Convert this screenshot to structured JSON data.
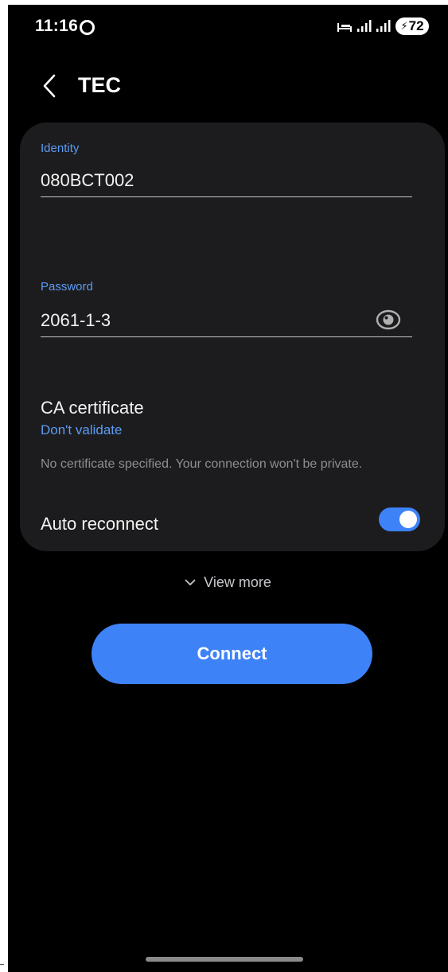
{
  "status_bar": {
    "time": "11:16",
    "battery_level": "72",
    "icons": [
      "circle-status-icon",
      "wifi-calling-icon",
      "signal-icon",
      "signal-icon",
      "battery-icon"
    ]
  },
  "header": {
    "title": "TEC",
    "back_icon": "chevron-left-icon"
  },
  "form": {
    "identity": {
      "label": "Identity",
      "value": "080BCT002"
    },
    "password": {
      "label": "Password",
      "value": "2061-1-3",
      "visibility_icon": "eye-icon"
    },
    "ca_certificate": {
      "label": "CA certificate",
      "value": "Don't validate",
      "note": "No certificate specified. Your connection won't be private."
    },
    "auto_reconnect": {
      "label": "Auto reconnect",
      "enabled": true
    }
  },
  "view_more": {
    "label": "View more",
    "icon": "chevron-down-icon"
  },
  "actions": {
    "connect_label": "Connect"
  },
  "colors": {
    "accent": "#3e82f7",
    "label_blue": "#5c9cf5",
    "card_background": "#1c1c1e",
    "background": "#000000"
  }
}
